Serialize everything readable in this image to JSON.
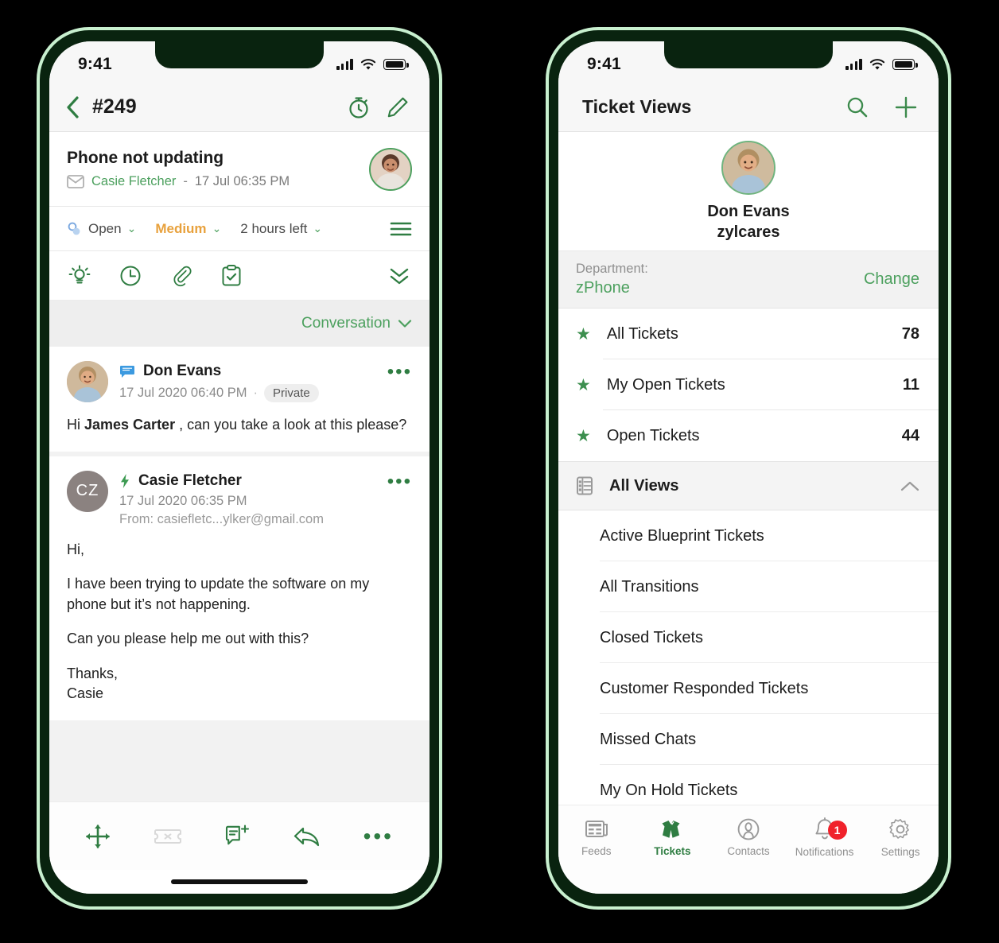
{
  "status_bar": {
    "time": "9:41",
    "signal_icon": "signal-bars-icon",
    "wifi_icon": "wifi-icon",
    "battery_icon": "battery-icon"
  },
  "left_phone": {
    "nav": {
      "back_icon": "chevron-left-icon",
      "title": "#249",
      "timer_icon": "stopwatch-icon",
      "edit_icon": "pencil-icon"
    },
    "ticket": {
      "subject": "Phone not updating",
      "channel_icon": "envelope-icon",
      "contact": "Casie Fletcher",
      "separator": "-",
      "timestamp": "17 Jul 06:35 PM",
      "avatar_name": "contact-avatar"
    },
    "meta": {
      "status_icon": "status-circles-icon",
      "status": "Open",
      "priority": "Medium",
      "due": "2 hours left",
      "menu_icon": "hamburger-icon",
      "caret": "⌄"
    },
    "actions": [
      {
        "name": "insights-icon",
        "label": "Insights"
      },
      {
        "name": "time-entry-icon",
        "label": "Time Entry"
      },
      {
        "name": "attachment-icon",
        "label": "Attachments"
      },
      {
        "name": "tasks-icon",
        "label": "Tasks"
      }
    ],
    "expand_icon": "double-chevron-down-icon",
    "conversation_filter": {
      "label": "Conversation",
      "caret": "⌄"
    },
    "messages": [
      {
        "avatar_type": "photo",
        "avatar_label": "",
        "type_icon": "comment-icon",
        "name": "Don Evans",
        "date": "17 Jul 2020 06:40 PM",
        "separator": "·",
        "badge": "Private",
        "from": "",
        "more_icon": "more-options-icon",
        "body_html": "Hi <b>James Carter</b> , can you take a look at this please?"
      },
      {
        "avatar_type": "initials",
        "avatar_label": "CZ",
        "type_icon": "email-bolt-icon",
        "name": "Casie Fletcher",
        "date": "17 Jul 2020 06:35 PM",
        "separator": "",
        "badge": "",
        "from": "From: casiefletc...ylker@gmail.com",
        "more_icon": "more-options-icon",
        "body_paragraphs": [
          "Hi,",
          "I have been trying to update the software on my phone but it’s not happening.",
          "Can you please help me out with this?",
          "Thanks,\nCasie"
        ]
      }
    ],
    "bottom_toolbar": [
      {
        "name": "move-icon",
        "label": "Move"
      },
      {
        "name": "ticket-close-icon",
        "label": "Close Ticket"
      },
      {
        "name": "add-comment-icon",
        "label": "Add Comment"
      },
      {
        "name": "reply-icon",
        "label": "Reply"
      },
      {
        "name": "more-icon",
        "label": "More"
      }
    ]
  },
  "right_phone": {
    "nav": {
      "title": "Ticket Views",
      "search_icon": "search-icon",
      "add_icon": "plus-icon"
    },
    "profile": {
      "avatar_name": "agent-avatar",
      "name": "Don Evans",
      "org": "zylcares"
    },
    "department": {
      "label": "Department:",
      "value": "zPhone",
      "change_label": "Change"
    },
    "favorites": [
      {
        "icon": "star-icon",
        "label": "All Tickets",
        "count": "78"
      },
      {
        "icon": "star-icon",
        "label": "My Open Tickets",
        "count": "11"
      },
      {
        "icon": "star-icon",
        "label": "Open Tickets",
        "count": "44"
      }
    ],
    "all_views": {
      "icon": "list-view-icon",
      "label": "All Views",
      "chevron_icon": "chevron-up-icon"
    },
    "views": [
      "Active Blueprint Tickets",
      "All Transitions",
      "Closed Tickets",
      "Customer Responded Tickets",
      "Missed Chats",
      "My On Hold Tickets"
    ],
    "tabs": [
      {
        "icon": "feeds-icon",
        "label": "Feeds",
        "active": false,
        "badge": ""
      },
      {
        "icon": "tickets-icon",
        "label": "Tickets",
        "active": true,
        "badge": ""
      },
      {
        "icon": "contacts-icon",
        "label": "Contacts",
        "active": false,
        "badge": ""
      },
      {
        "icon": "bell-icon",
        "label": "Notifications",
        "active": false,
        "badge": "1"
      },
      {
        "icon": "gear-icon",
        "label": "Settings",
        "active": false,
        "badge": ""
      }
    ]
  },
  "colors": {
    "brand_green": "#4ca05e",
    "dark_green": "#2f7d42",
    "frame_dark": "#09230f",
    "frame_edge": "#c8f0cf",
    "priority_orange": "#e8a13c",
    "badge_red": "#f0222b",
    "background": "#000000"
  }
}
